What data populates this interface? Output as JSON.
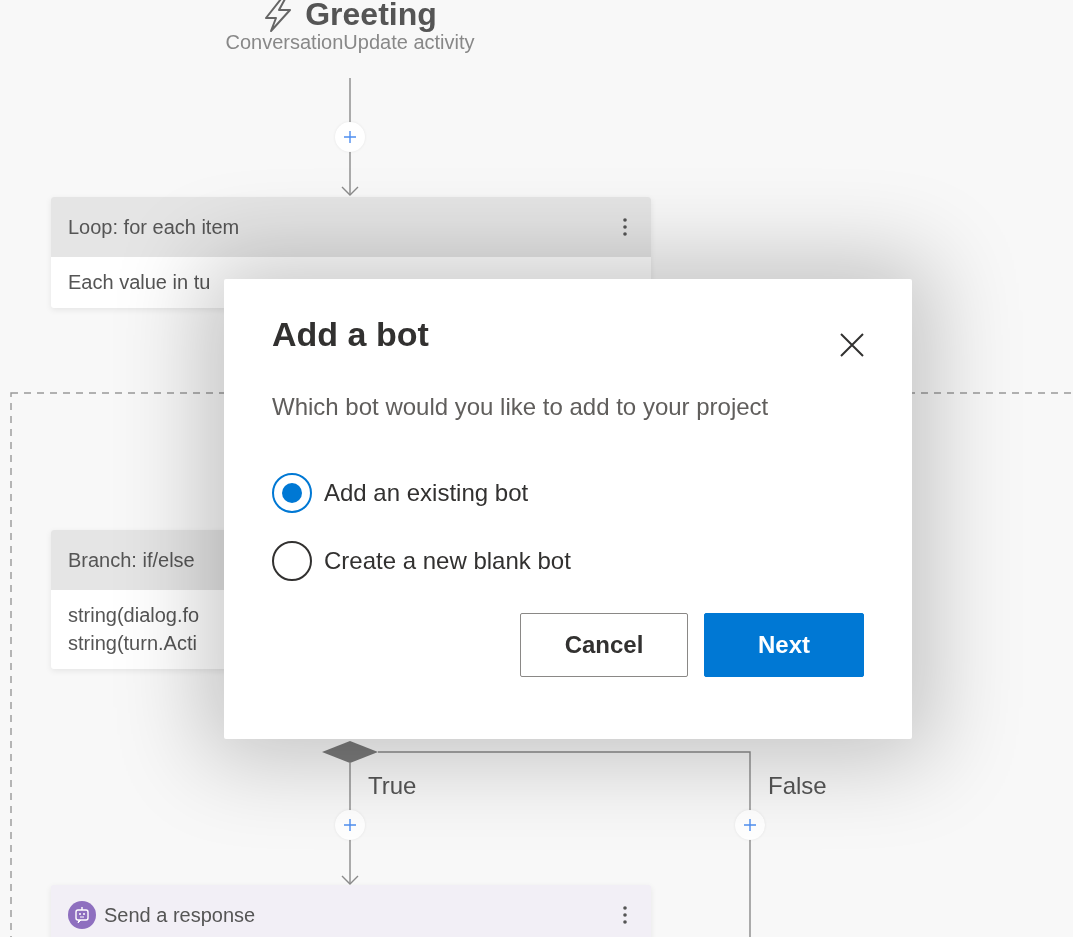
{
  "trigger": {
    "title": "Greeting",
    "subtitle": "ConversationUpdate activity"
  },
  "nodes": [
    {
      "kind": "action",
      "title": "Loop: for each item",
      "body": [
        "Each value in tu"
      ]
    },
    {
      "kind": "action",
      "title": "Branch: if/else",
      "body": [
        "string(dialog.fo",
        "string(turn.Acti"
      ]
    },
    {
      "kind": "response",
      "title": "Send a response"
    }
  ],
  "branch_labels": [
    "True",
    "False"
  ],
  "dialog": {
    "title": "Add a bot",
    "prompt": "Which bot would you like to add to your project",
    "options": [
      {
        "label": "Add an existing bot",
        "selected": true
      },
      {
        "label": "Create a new blank bot",
        "selected": false
      }
    ],
    "buttons": [
      {
        "label": "Cancel",
        "kind": "secondary"
      },
      {
        "label": "Next",
        "kind": "primary"
      }
    ]
  }
}
